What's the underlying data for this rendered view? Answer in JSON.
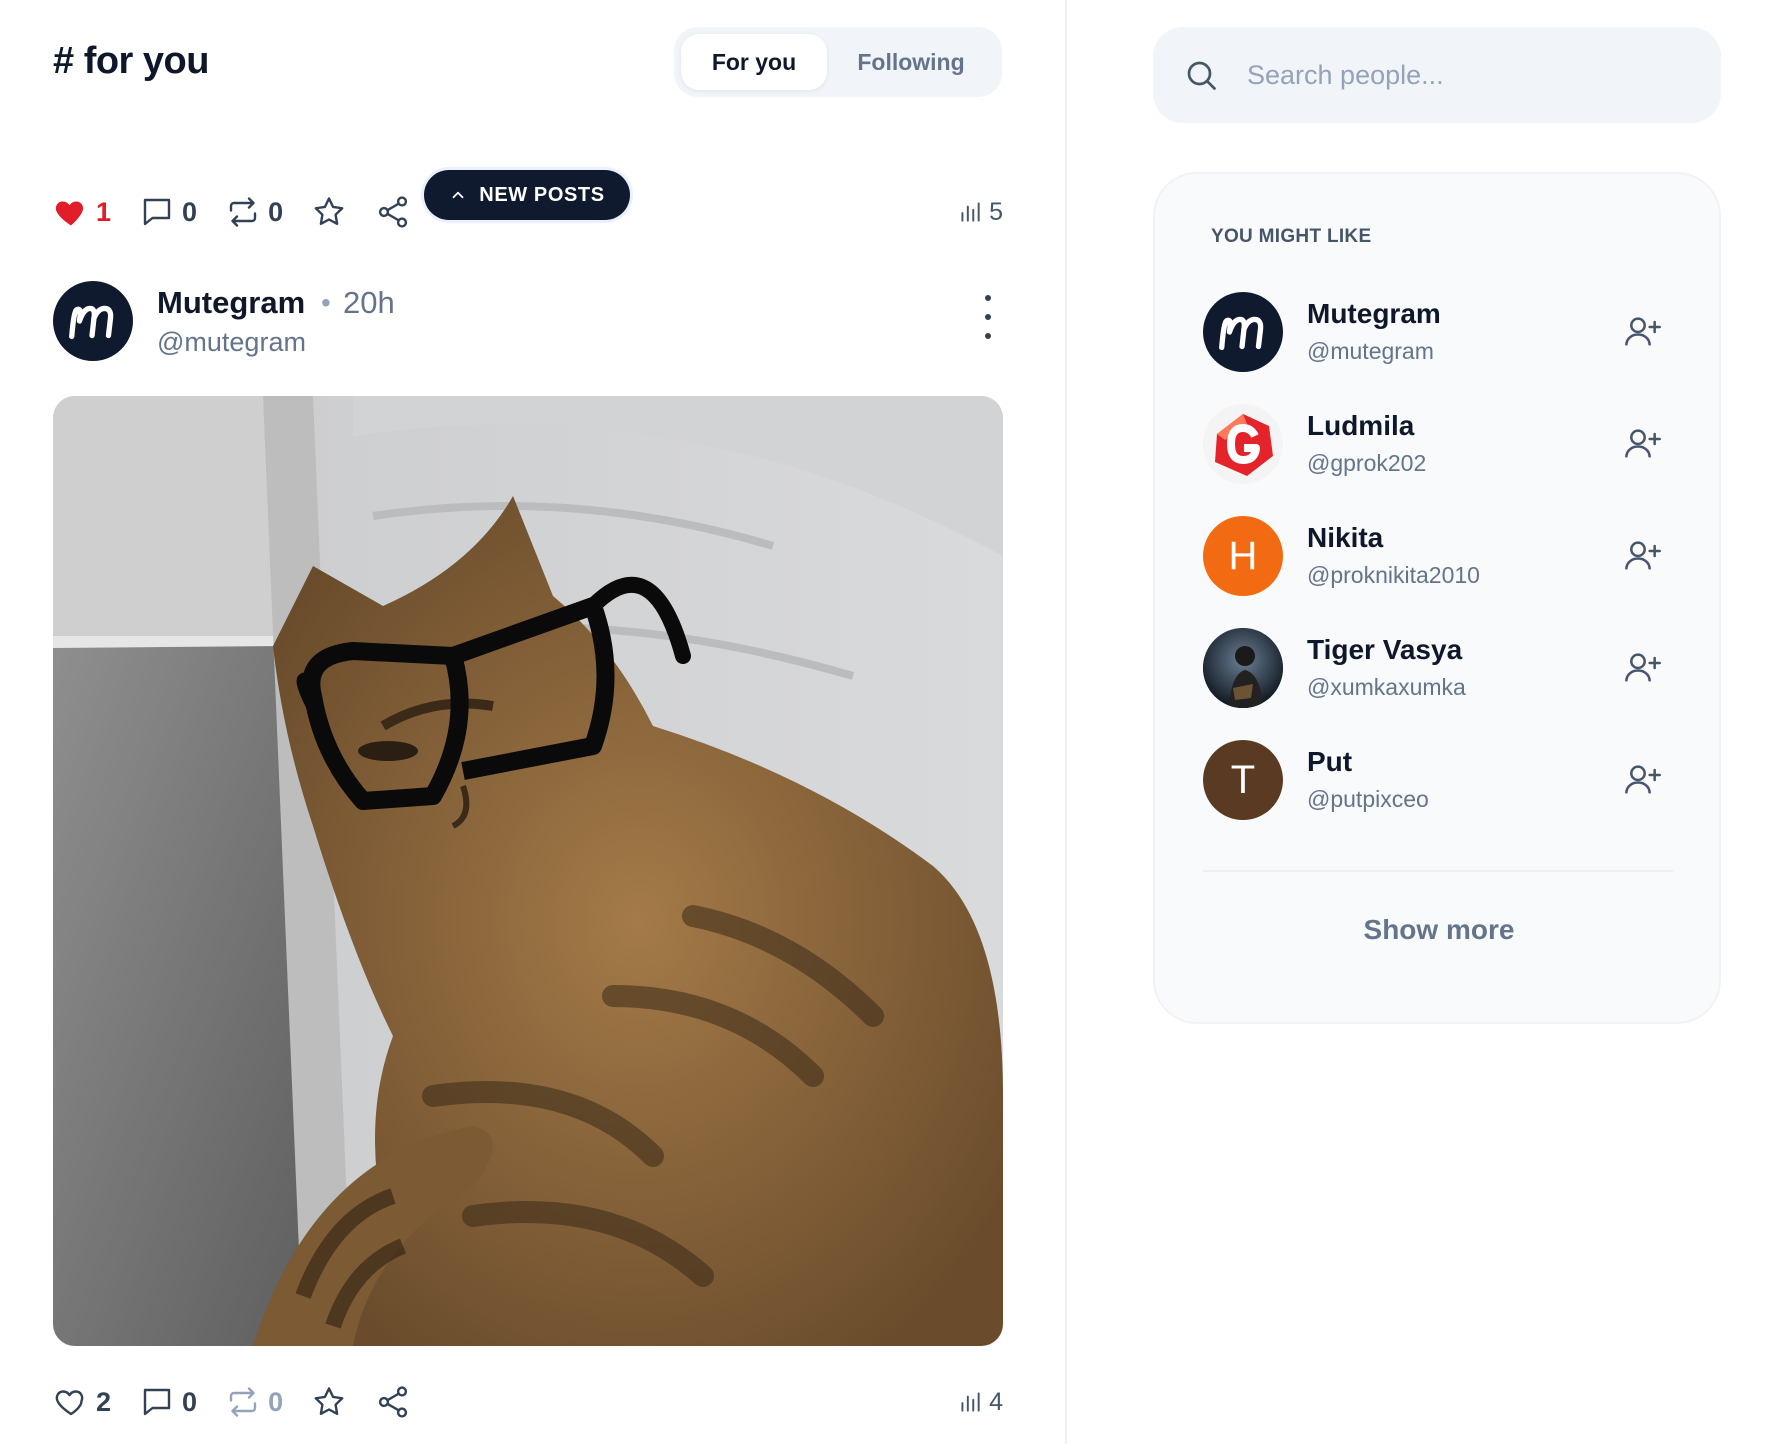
{
  "feed": {
    "title": "# for you",
    "tabs": [
      {
        "label": "For you",
        "active": true
      },
      {
        "label": "Following",
        "active": false
      }
    ],
    "new_posts_label": "NEW POSTS"
  },
  "top_post_actions": {
    "likes": "1",
    "liked": true,
    "comments": "0",
    "reposts": "0",
    "views": "5"
  },
  "post": {
    "author_name": "Mutegram",
    "time": "20h",
    "handle": "@mutegram",
    "actions": {
      "likes": "2",
      "comments": "0",
      "reposts": "0",
      "views": "4"
    }
  },
  "sidebar": {
    "search_placeholder": "Search people...",
    "suggest_title": "YOU MIGHT LIKE",
    "people": [
      {
        "name": "Mutegram",
        "handle": "@mutegram",
        "avatar": "mutegram-logo"
      },
      {
        "name": "Ludmila",
        "handle": "@gprok202",
        "avatar": "g-logo"
      },
      {
        "name": "Nikita",
        "handle": "@proknikita2010",
        "avatar": "letter",
        "letter": "H",
        "color": "#f26a12"
      },
      {
        "name": "Tiger Vasya",
        "handle": "@xumkaxumka",
        "avatar": "photo"
      },
      {
        "name": "Put",
        "handle": "@putpixceo",
        "avatar": "letter",
        "letter": "T",
        "color": "#5b3a24"
      }
    ],
    "show_more_label": "Show more"
  },
  "colors": {
    "accent_dark": "#0f1a2e",
    "like_red": "#e11d2a",
    "muted_text": "#64748b",
    "panel_bg": "#f8fafc"
  }
}
